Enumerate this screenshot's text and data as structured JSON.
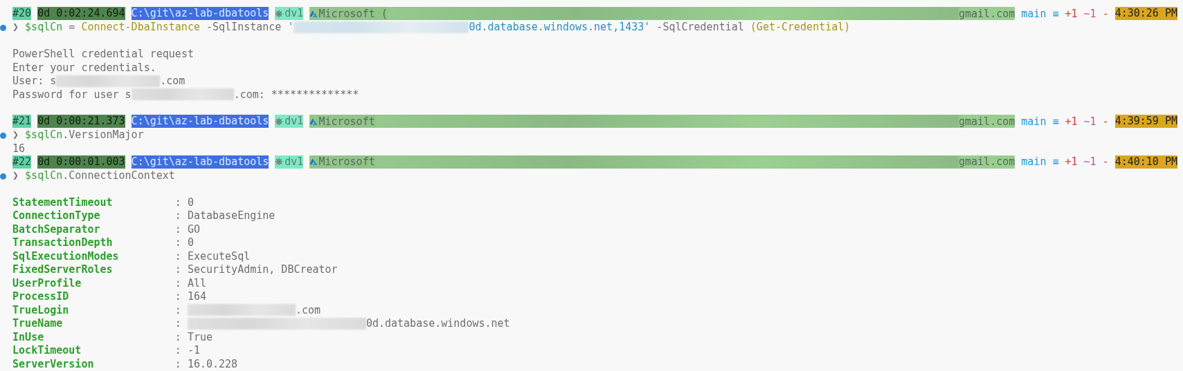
{
  "lines": [
    {
      "kind": "prompt",
      "number": "#20",
      "duration": "0d 0:02:24.694",
      "path": "C:\\git\\az-lab-dbatools",
      "context": "dv1",
      "account": "Microsoft (",
      "email": "gmail.com",
      "branch": "main",
      "status": "≡",
      "added": "+1",
      "modified": "~1",
      "dash": "-",
      "time": "4:30:26 PM"
    },
    {
      "kind": "command",
      "marker": "●",
      "chevron": "❯",
      "tokens": [
        {
          "kind": "variable",
          "text": "$sqlCn"
        },
        {
          "kind": "plain",
          "text": " = "
        },
        {
          "kind": "cmdlet",
          "text": "Connect-DbaInstance"
        },
        {
          "kind": "plain",
          "text": " -SqlInstance "
        },
        {
          "kind": "string",
          "text": "'"
        },
        {
          "kind": "redacted"
        },
        {
          "kind": "string",
          "text": "0d.database.windows.net,1433'"
        },
        {
          "kind": "plain",
          "text": " -SqlCredential "
        },
        {
          "kind": "cmdlet",
          "text": "(Get-Credential)"
        }
      ]
    },
    {
      "kind": "blank"
    },
    {
      "kind": "output",
      "parts": [
        {
          "kind": "text",
          "text": "PowerShell credential request"
        }
      ]
    },
    {
      "kind": "output",
      "parts": [
        {
          "kind": "text",
          "text": "Enter your credentials."
        }
      ]
    },
    {
      "kind": "output",
      "parts": [
        {
          "kind": "text",
          "text": "User: s"
        },
        {
          "kind": "redacted"
        },
        {
          "kind": "text",
          "text": ".com"
        }
      ]
    },
    {
      "kind": "output",
      "parts": [
        {
          "kind": "text",
          "text": "Password for user s"
        },
        {
          "kind": "redacted"
        },
        {
          "kind": "text",
          "text": ".com: **************"
        }
      ]
    },
    {
      "kind": "blank"
    },
    {
      "kind": "prompt",
      "number": "#21",
      "duration": "0d 0:00:21.373",
      "path": "C:\\git\\az-lab-dbatools",
      "context": "dv1",
      "account": "Microsoft",
      "email": "gmail.com",
      "branch": "main",
      "status": "≡",
      "added": "+1",
      "modified": "~1",
      "dash": "-",
      "time": "4:39:59 PM"
    },
    {
      "kind": "command",
      "marker": "●",
      "chevron": "❯",
      "tokens": [
        {
          "kind": "variable",
          "text": "$sqlCn"
        },
        {
          "kind": "plain",
          "text": ".VersionMajor"
        }
      ]
    },
    {
      "kind": "output",
      "parts": [
        {
          "kind": "text",
          "text": "16"
        }
      ]
    },
    {
      "kind": "prompt",
      "number": "#22",
      "duration": "0d 0:00:01.003",
      "path": "C:\\git\\az-lab-dbatools",
      "context": "dv1",
      "account": "Microsoft",
      "email": "gmail.com",
      "branch": "main",
      "status": "≡",
      "added": "+1",
      "modified": "~1",
      "dash": "-",
      "time": "4:40:10 PM"
    },
    {
      "kind": "command",
      "marker": "●",
      "chevron": "❯",
      "tokens": [
        {
          "kind": "variable",
          "text": "$sqlCn"
        },
        {
          "kind": "plain",
          "text": ".ConnectionContext"
        }
      ]
    },
    {
      "kind": "blank"
    },
    {
      "kind": "property",
      "name": "StatementTimeout",
      "separator": ":",
      "parts": [
        {
          "kind": "text",
          "text": "0"
        }
      ]
    },
    {
      "kind": "property",
      "name": "ConnectionType",
      "separator": ":",
      "parts": [
        {
          "kind": "text",
          "text": "DatabaseEngine"
        }
      ]
    },
    {
      "kind": "property",
      "name": "BatchSeparator",
      "separator": ":",
      "parts": [
        {
          "kind": "text",
          "text": "GO"
        }
      ]
    },
    {
      "kind": "property",
      "name": "TransactionDepth",
      "separator": ":",
      "parts": [
        {
          "kind": "text",
          "text": "0"
        }
      ]
    },
    {
      "kind": "property",
      "name": "SqlExecutionModes",
      "separator": ":",
      "parts": [
        {
          "kind": "text",
          "text": "ExecuteSql"
        }
      ]
    },
    {
      "kind": "property",
      "name": "FixedServerRoles",
      "separator": ":",
      "parts": [
        {
          "kind": "text",
          "text": "SecurityAdmin, DBCreator"
        }
      ]
    },
    {
      "kind": "property",
      "name": "UserProfile",
      "separator": ":",
      "parts": [
        {
          "kind": "text",
          "text": "All"
        }
      ]
    },
    {
      "kind": "property",
      "name": "ProcessID",
      "separator": ":",
      "parts": [
        {
          "kind": "text",
          "text": "164"
        }
      ]
    },
    {
      "kind": "property",
      "name": "TrueLogin",
      "separator": ":",
      "parts": [
        {
          "kind": "redacted"
        },
        {
          "kind": "text",
          "text": ".com"
        }
      ]
    },
    {
      "kind": "property",
      "name": "TrueName",
      "separator": ":",
      "parts": [
        {
          "kind": "redacted"
        },
        {
          "kind": "text",
          "text": "0d.database.windows.net"
        }
      ]
    },
    {
      "kind": "property",
      "name": "InUse",
      "separator": ":",
      "parts": [
        {
          "kind": "text",
          "text": "True"
        }
      ]
    },
    {
      "kind": "property",
      "name": "LockTimeout",
      "separator": ":",
      "parts": [
        {
          "kind": "text",
          "text": "-1"
        }
      ]
    },
    {
      "kind": "property",
      "name": "ServerVersion",
      "separator": ":",
      "parts": [
        {
          "kind": "text",
          "text": "16.0.228"
        }
      ]
    }
  ]
}
